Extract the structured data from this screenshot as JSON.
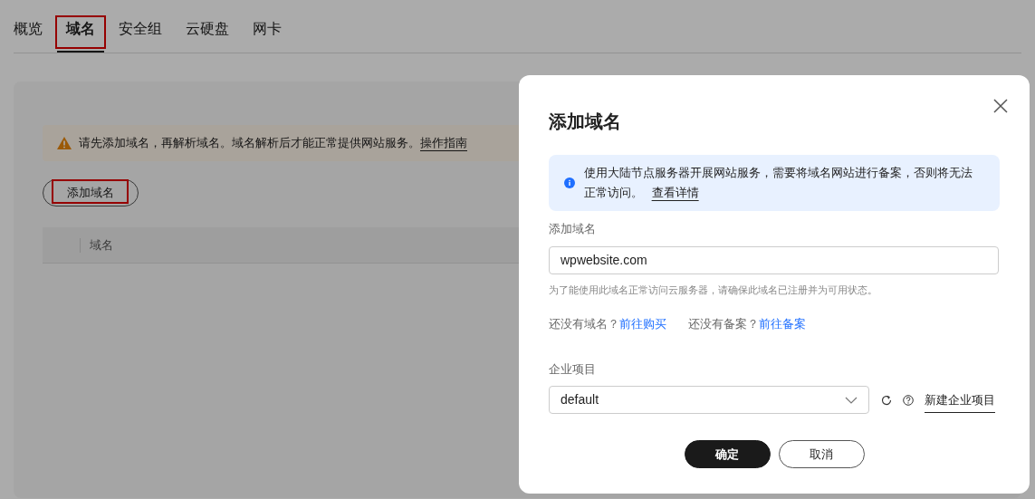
{
  "tabs": [
    {
      "label": "概览",
      "selected": false,
      "highlighted": false
    },
    {
      "label": "域名",
      "selected": true,
      "highlighted": true
    },
    {
      "label": "安全组",
      "selected": false,
      "highlighted": false
    },
    {
      "label": "云硬盘",
      "selected": false,
      "highlighted": false
    },
    {
      "label": "网卡",
      "selected": false,
      "highlighted": false
    }
  ],
  "notice": {
    "text": "请先添加域名，再解析域名。域名解析后才能正常提供网站服务。",
    "link": "操作指南"
  },
  "add_button": {
    "label": "添加域名",
    "highlighted": true
  },
  "table": {
    "columns": [
      "域名"
    ]
  },
  "dialog": {
    "title": "添加域名",
    "info": {
      "text": "使用大陆节点服务器开展网站服务，需要将域名网站进行备案，否则将无法正常访问。",
      "link": "查看详情"
    },
    "domain_field": {
      "label": "添加域名",
      "value": "wpwebsite.com",
      "hint": "为了能使用此域名正常访问云服务器，请确保此域名已注册并为可用状态。"
    },
    "links": [
      {
        "text": "还没有域名？",
        "link": "前往购买"
      },
      {
        "text": "还没有备案？",
        "link": "前往备案"
      }
    ],
    "project_field": {
      "label": "企业项目",
      "value": "default",
      "create_link": "新建企业项目"
    },
    "buttons": [
      {
        "label": "确定",
        "kind": "primary"
      },
      {
        "label": "取消",
        "kind": "secondary"
      }
    ]
  }
}
